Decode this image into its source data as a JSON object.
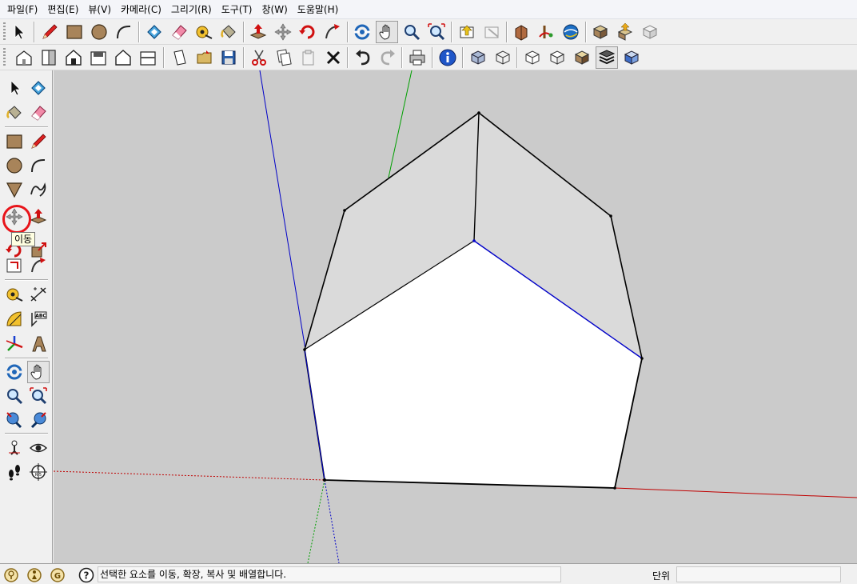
{
  "menu": [
    "파일(F)",
    "편집(E)",
    "뷰(V)",
    "카메라(C)",
    "그리기(R)",
    "도구(T)",
    "창(W)",
    "도움말(H)"
  ],
  "tooltip": "이동",
  "status": {
    "message": "선택한 요소를 이동, 확장, 복사 및 배열합니다.",
    "units_label": "단위",
    "units_value": ""
  },
  "colors": {
    "viewport_bg": "#cbcbcb",
    "axis_red": "#c00000",
    "axis_green": "#00a000",
    "axis_blue": "#0000c8",
    "highlight": "#e8141a",
    "face_front": "#ffffff",
    "face_shade": "#dadada"
  }
}
